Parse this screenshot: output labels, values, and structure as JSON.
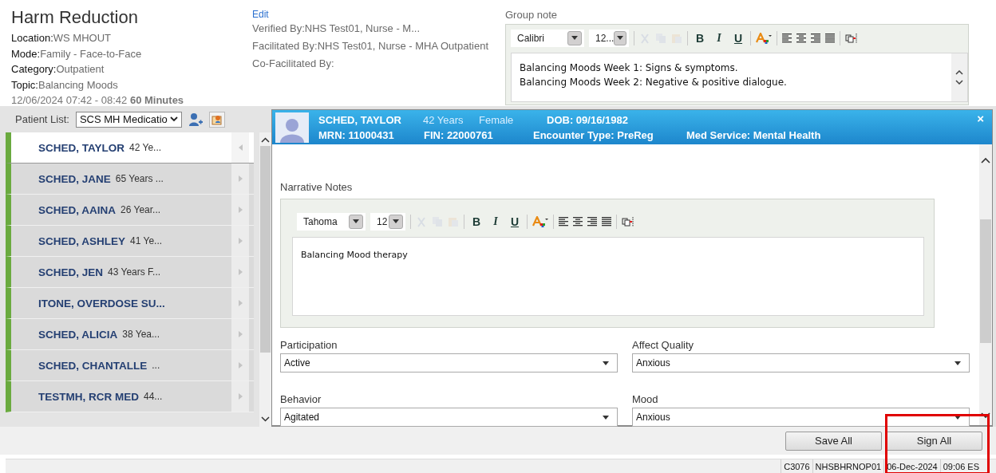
{
  "header": {
    "title": "Harm Reduction",
    "fields": [
      {
        "label": "Location:",
        "value": "WS MHOUT"
      },
      {
        "label": "Mode:",
        "value": "Family - Face-to-Face"
      },
      {
        "label": "Category:",
        "value": "Outpatient"
      },
      {
        "label": "Topic:",
        "value": "Balancing Moods"
      }
    ],
    "time_range": "12/06/2024 07:42 - 08:42 **60 Minutes**"
  },
  "staff": {
    "edit_link": "Edit",
    "lines": [
      "Verified By:NHS Test01, Nurse - M...",
      "Facilitated By:NHS Test01, Nurse - MHA Outpatient",
      "Co-Facilitated By:"
    ]
  },
  "group_note": {
    "label": "Group note",
    "font": "Calibri",
    "size": "12...",
    "format_buttons": [
      "B",
      "I",
      "U"
    ],
    "text_lines": [
      "Balancing Moods Week 1: Signs & symptoms.",
      "Balancing Moods Week 2: Negative & positive dialogue."
    ]
  },
  "patient_list": {
    "label": "Patient List:",
    "list_name": "SCS MH Medicatio",
    "patients": [
      {
        "name": "SCHED, TAYLOR",
        "details": "42 Ye...",
        "selected": true
      },
      {
        "name": "SCHED, JANE",
        "details": "65 Years ...",
        "selected": false
      },
      {
        "name": "SCHED, AAINA",
        "details": "26 Year...",
        "selected": false
      },
      {
        "name": "SCHED, ASHLEY",
        "details": "41 Ye...",
        "selected": false
      },
      {
        "name": "SCHED, JEN",
        "details": "43 Years F...",
        "selected": false
      },
      {
        "name": "ITONE, OVERDOSE SU...",
        "selected": false
      },
      {
        "name": "SCHED, ALICIA",
        "details": "38 Yea...",
        "selected": false
      },
      {
        "name": "SCHED, CHANTALLE",
        "details": "...",
        "selected": false
      },
      {
        "name": "TESTMH, RCR MED",
        "details": "44...",
        "selected": false
      }
    ]
  },
  "encounter": {
    "name": "SCHED, TAYLOR",
    "age": "42 Years",
    "sex": "Female",
    "dob": "DOB: 09/16/1982",
    "mrn": "MRN: 11000431",
    "fin": "FIN: 22000761",
    "encounter_type": "Encounter Type: PreReg",
    "med_service": "Med Service: Mental Health",
    "close": "×",
    "narrative": {
      "label": "Narrative Notes",
      "font": "Tahoma",
      "size": "12",
      "format_buttons": [
        "B",
        "I",
        "U"
      ],
      "text_lines": [
        "Balancing Mood therapy"
      ]
    },
    "fields": [
      {
        "label": "Participation",
        "value": "Active"
      },
      {
        "label": "Affect Quality",
        "value": "Anxious"
      },
      {
        "label": "Behavior",
        "value": "Agitated"
      },
      {
        "label": "Mood",
        "value": "Anxious"
      }
    ]
  },
  "actions": [
    "Save All",
    "Sign All"
  ],
  "status_bar": [
    "C3076",
    "NHSBHRNOP01",
    "06-Dec-2024",
    "09:06 ES"
  ]
}
